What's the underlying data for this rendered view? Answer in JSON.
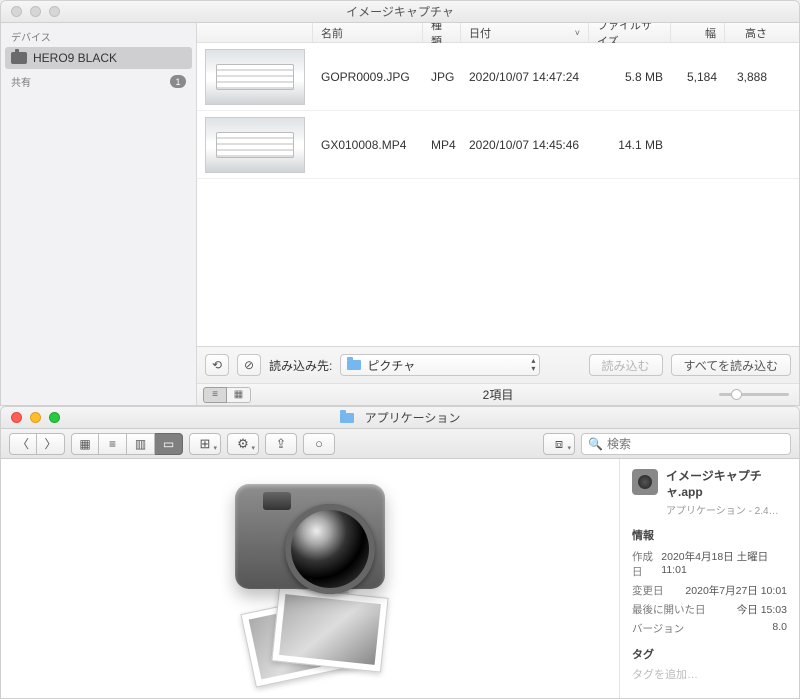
{
  "imageCapture": {
    "title": "イメージキャプチャ",
    "sidebar": {
      "devices_header": "デバイス",
      "device_name": "HERO9 BLACK",
      "share_header": "共有",
      "share_badge": "1"
    },
    "columns": {
      "name": "名前",
      "kind": "種類",
      "date": "日付",
      "size": "ファイルサイズ",
      "width": "幅",
      "height": "高さ"
    },
    "rows": [
      {
        "name": "GOPR0009.JPG",
        "kind": "JPG",
        "date": "2020/10/07 14:47:24",
        "size": "5.8 MB",
        "w": "5,184",
        "h": "3,888"
      },
      {
        "name": "GX010008.MP4",
        "kind": "MP4",
        "date": "2020/10/07 14:45:46",
        "size": "14.1 MB",
        "w": "",
        "h": ""
      }
    ],
    "footer": {
      "import_to_label": "読み込み先:",
      "dest_folder": "ピクチャ",
      "import_btn": "読み込む",
      "import_all_btn": "すべてを読み込む",
      "status": "2項目"
    }
  },
  "finder": {
    "title": "アプリケーション",
    "search_placeholder": "検索",
    "info": {
      "app_name": "イメージキャプチャ.app",
      "kind_line": "アプリケーション - 2.4…",
      "section_info": "情報",
      "created_k": "作成日",
      "created_v": "2020年4月18日 土曜日 11:01",
      "modified_k": "変更日",
      "modified_v": "2020年7月27日 10:01",
      "opened_k": "最後に開いた日",
      "opened_v": "今日 15:03",
      "version_k": "バージョン",
      "version_v": "8.0",
      "section_tags": "タグ",
      "tags_placeholder": "タグを追加…"
    }
  }
}
